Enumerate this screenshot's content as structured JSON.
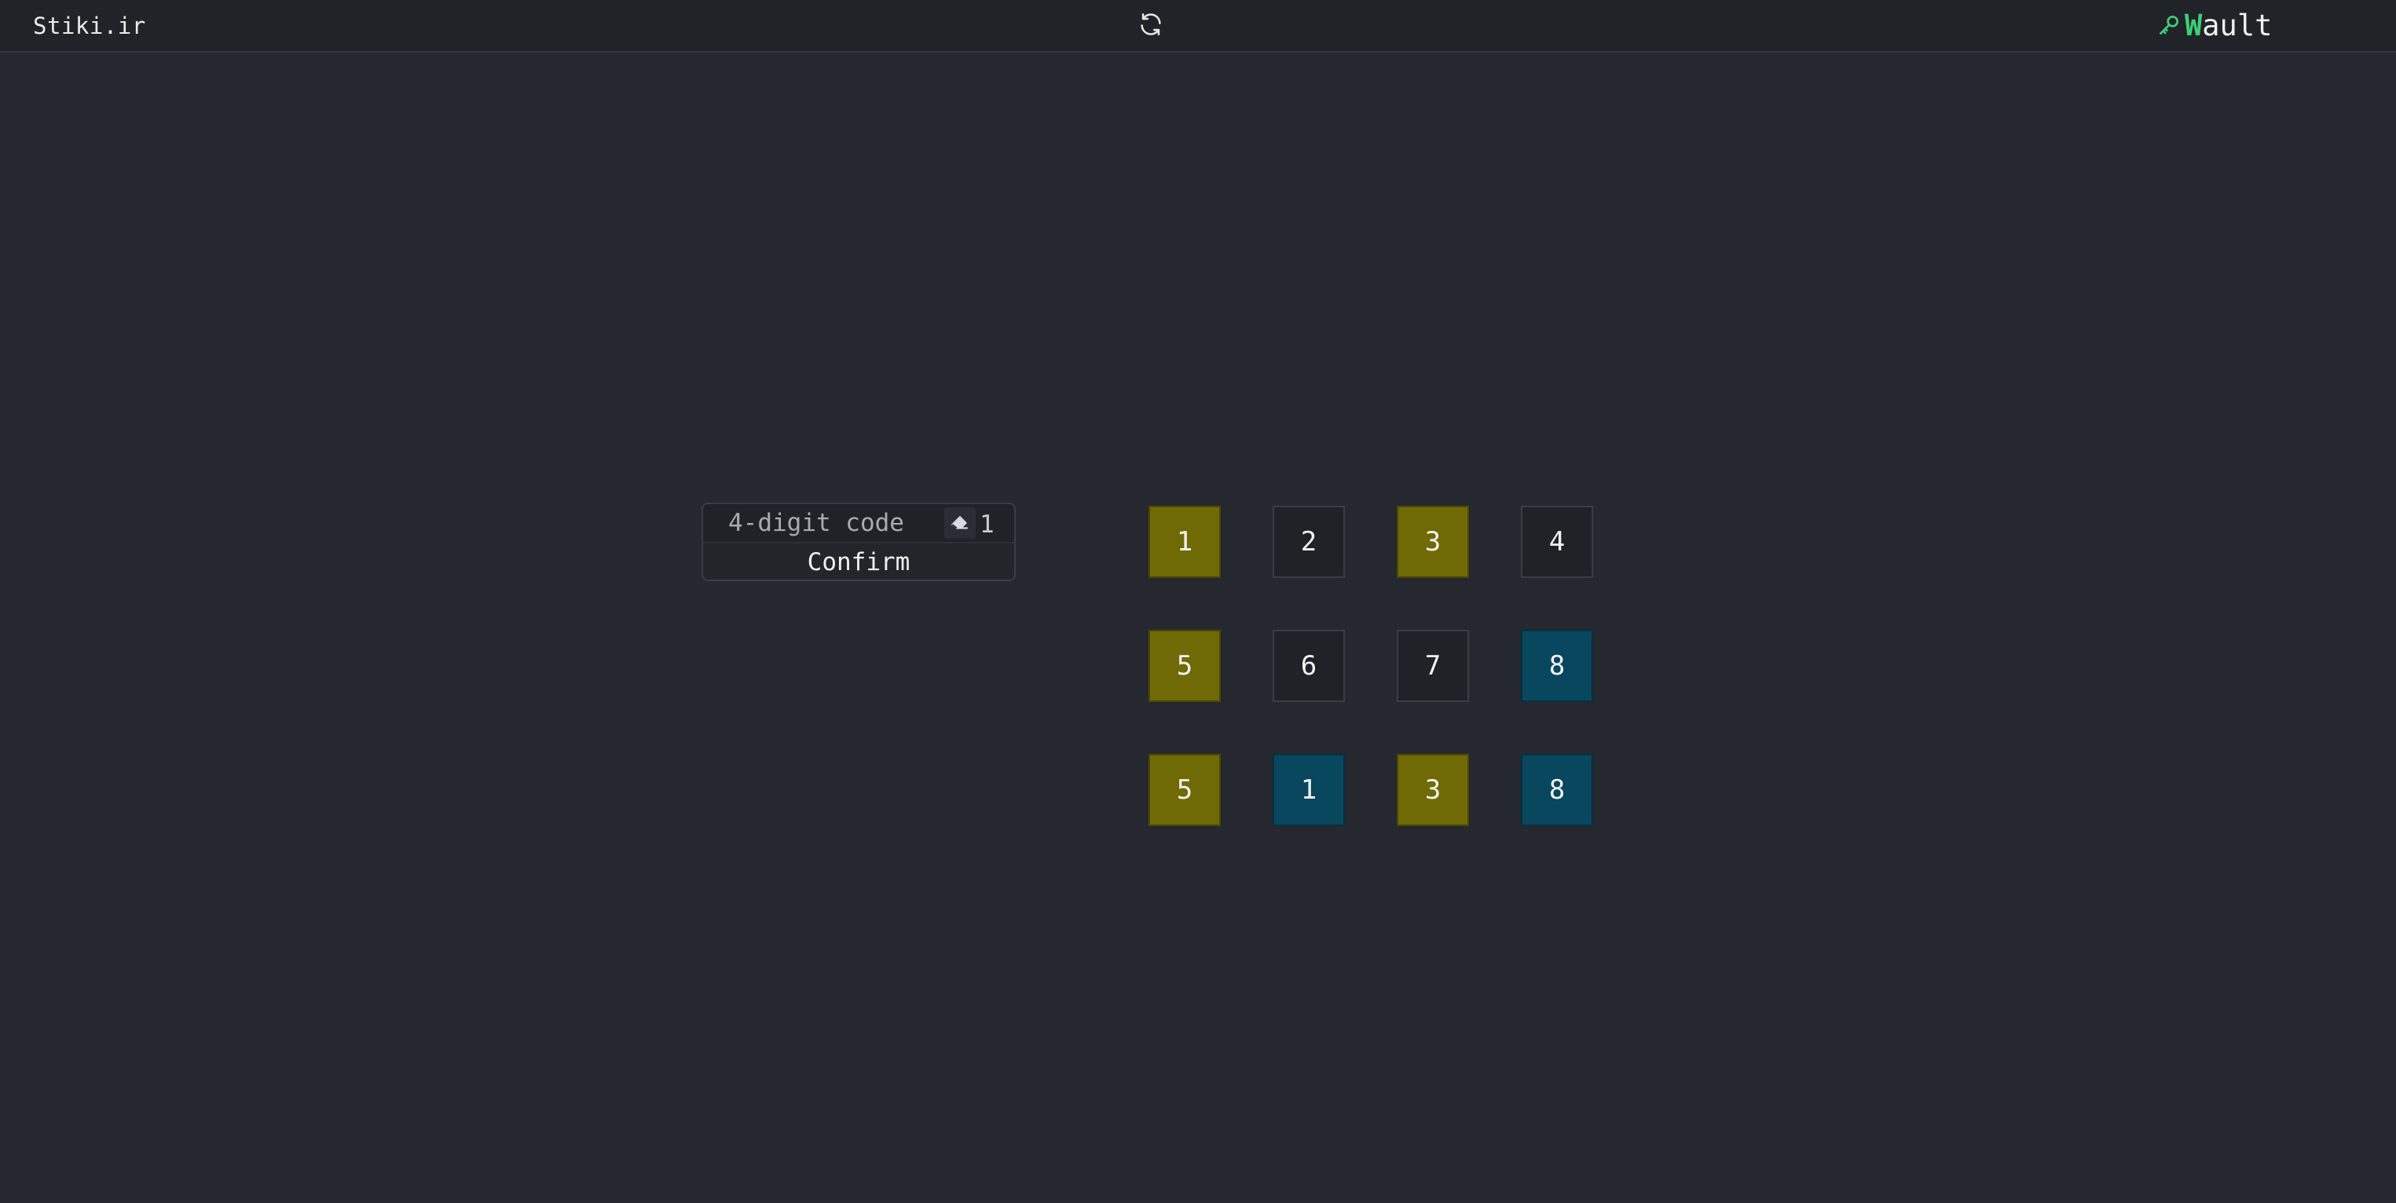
{
  "header": {
    "brand": "Stiki.ir",
    "refresh_icon": "refresh-icon",
    "wault_first_letter": "W",
    "wault_rest": "ault",
    "wault_icon": "key-icon",
    "accent_color": "#3ecf74"
  },
  "code_panel": {
    "placeholder": "4-digit code",
    "input_value": "",
    "eraser_icon": "eraser-icon",
    "attempt_count": "1",
    "confirm_label": "Confirm"
  },
  "tiles": {
    "row1": [
      {
        "label": "1",
        "state": "yellow"
      },
      {
        "label": "2",
        "state": "default"
      },
      {
        "label": "3",
        "state": "yellow"
      },
      {
        "label": "4",
        "state": "default"
      }
    ],
    "row2": [
      {
        "label": "5",
        "state": "yellow"
      },
      {
        "label": "6",
        "state": "default"
      },
      {
        "label": "7",
        "state": "default"
      },
      {
        "label": "8",
        "state": "blue"
      }
    ],
    "row3": [
      {
        "label": "5",
        "state": "yellow"
      },
      {
        "label": "1",
        "state": "blue"
      },
      {
        "label": "3",
        "state": "yellow"
      },
      {
        "label": "8",
        "state": "blue"
      }
    ]
  },
  "colors": {
    "yellow": "#6f6a05",
    "blue": "#08475e",
    "default": "#1f2226",
    "background": "#25282e"
  }
}
